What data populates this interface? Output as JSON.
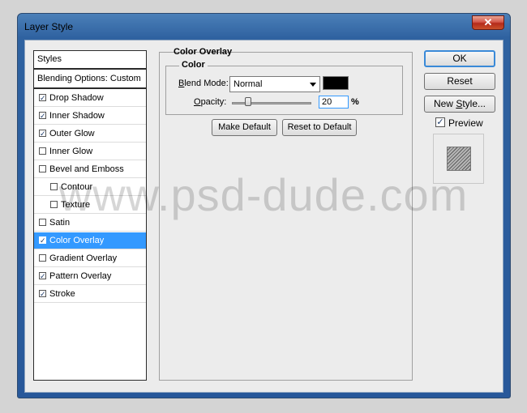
{
  "window": {
    "title": "Layer Style",
    "close_glyph": "✕"
  },
  "styles_list": [
    {
      "label": "Styles",
      "checkbox": false,
      "checked": false,
      "indent": 0,
      "selected": false,
      "thick": true
    },
    {
      "label": "Blending Options: Custom",
      "checkbox": false,
      "checked": false,
      "indent": 0,
      "selected": false,
      "thick": true
    },
    {
      "label": "Drop Shadow",
      "checkbox": true,
      "checked": true,
      "indent": 0,
      "selected": false
    },
    {
      "label": "Inner Shadow",
      "checkbox": true,
      "checked": true,
      "indent": 0,
      "selected": false
    },
    {
      "label": "Outer Glow",
      "checkbox": true,
      "checked": true,
      "indent": 0,
      "selected": false
    },
    {
      "label": "Inner Glow",
      "checkbox": true,
      "checked": false,
      "indent": 0,
      "selected": false
    },
    {
      "label": "Bevel and Emboss",
      "checkbox": true,
      "checked": false,
      "indent": 0,
      "selected": false
    },
    {
      "label": "Contour",
      "checkbox": true,
      "checked": false,
      "indent": 1,
      "selected": false
    },
    {
      "label": "Texture",
      "checkbox": true,
      "checked": false,
      "indent": 1,
      "selected": false
    },
    {
      "label": "Satin",
      "checkbox": true,
      "checked": false,
      "indent": 0,
      "selected": false
    },
    {
      "label": "Color Overlay",
      "checkbox": true,
      "checked": true,
      "indent": 0,
      "selected": true
    },
    {
      "label": "Gradient Overlay",
      "checkbox": true,
      "checked": false,
      "indent": 0,
      "selected": false
    },
    {
      "label": "Pattern Overlay",
      "checkbox": true,
      "checked": true,
      "indent": 0,
      "selected": false
    },
    {
      "label": "Stroke",
      "checkbox": true,
      "checked": true,
      "indent": 0,
      "selected": false
    }
  ],
  "color_overlay": {
    "title": "Color Overlay",
    "section": "Color",
    "blend_mode_label": "Blend Mode:",
    "blend_mode_value": "Normal",
    "overlay_color": "#000000",
    "opacity_label": "Opacity:",
    "opacity_value": "20",
    "opacity_unit": "%",
    "make_default": "Make Default",
    "reset_default": "Reset to Default"
  },
  "buttons": {
    "ok": "OK",
    "reset": "Reset",
    "new_style": "New Style..."
  },
  "preview": {
    "label": "Preview",
    "checked": true
  },
  "watermark": "www.psd-dude.com"
}
